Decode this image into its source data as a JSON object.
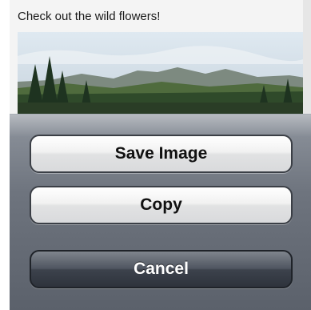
{
  "message": {
    "text": "Check out the wild flowers!"
  },
  "action_sheet": {
    "save_image_label": "Save Image",
    "copy_label": "Copy",
    "cancel_label": "Cancel"
  }
}
